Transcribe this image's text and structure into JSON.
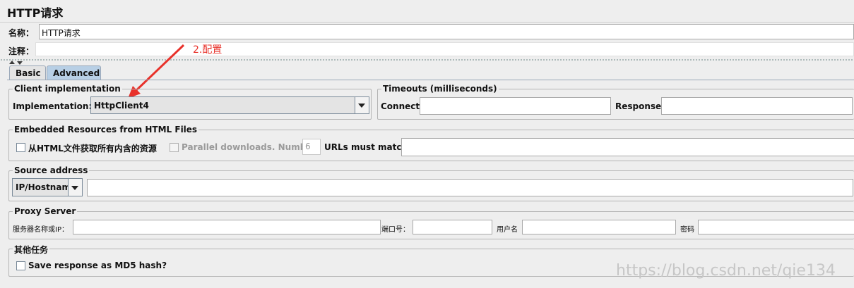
{
  "header": {
    "title": "HTTP请求"
  },
  "name_row": {
    "label": "名称：",
    "value": "HTTP请求"
  },
  "comment_row": {
    "label": "注释：",
    "value": ""
  },
  "annotation": {
    "text": "2.配置"
  },
  "tabs": [
    {
      "label": "Basic",
      "active": false
    },
    {
      "label": "Advanced",
      "active": true
    }
  ],
  "client_impl": {
    "legend": "Client implementation",
    "label": "Implementation:",
    "selected": "HttpClient4"
  },
  "timeouts": {
    "legend": "Timeouts (milliseconds)",
    "connect_label": "Connect:",
    "connect_value": "",
    "response_label": "Response:",
    "response_value": ""
  },
  "embedded": {
    "legend": "Embedded Resources from HTML Files",
    "retrieve_label": "从HTML文件获取所有内含的资源",
    "retrieve_checked": false,
    "parallel_label": "Parallel downloads. Number:",
    "parallel_checked": false,
    "parallel_value": "6",
    "urls_label": "URLs must match:",
    "urls_value": ""
  },
  "source": {
    "legend": "Source address",
    "type_selected": "IP/Hostname",
    "address_value": ""
  },
  "proxy": {
    "legend": "Proxy Server",
    "server_label": "服务器名称或IP：",
    "port_label": "端口号：",
    "user_label": "用户名",
    "password_label": "密码"
  },
  "other": {
    "legend": "其他任务",
    "md5_label": "Save response as MD5 hash?",
    "md5_checked": false
  },
  "watermark": {
    "text": "https://blog.csdn.net/qie134"
  },
  "colors": {
    "annotation": "#e8312a",
    "tab_active": "#b8cfe5",
    "panel": "#eeeeee"
  }
}
